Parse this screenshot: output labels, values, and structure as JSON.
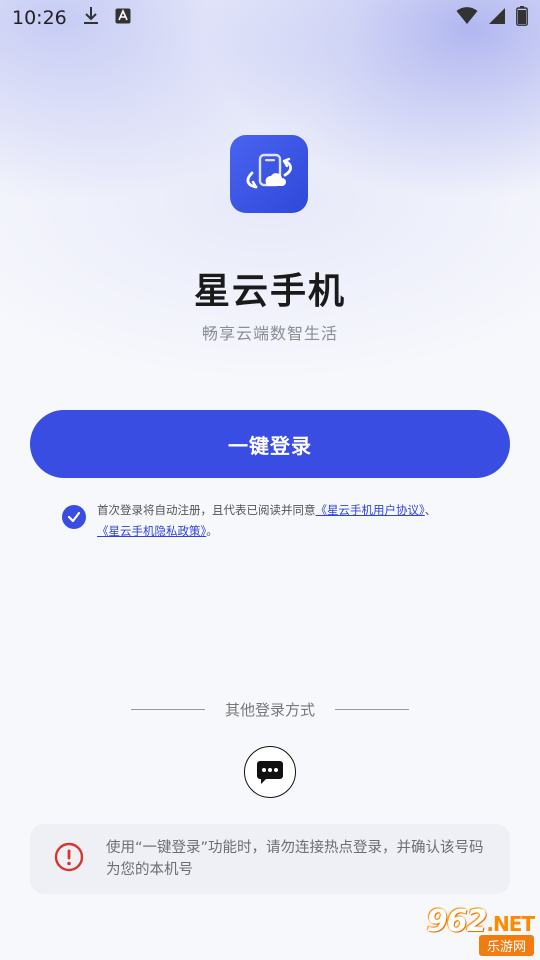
{
  "status_bar": {
    "time": "10:26",
    "icons": [
      "download-icon",
      "a-notification-icon",
      "wifi-icon",
      "cellular-signal-icon",
      "battery-icon"
    ]
  },
  "app": {
    "name": "星云手机",
    "subtitle": "畅享云端数智生活",
    "icon": "app-logo-icon",
    "brand_color": "#3a4de3"
  },
  "login": {
    "one_click_label": "一键登录"
  },
  "agreement": {
    "checked": true,
    "prefix": "首次登录将自动注册，且代表已阅读并同意",
    "user_agreement": "《星云手机用户协议》",
    "separator": "、",
    "privacy_policy": "《星云手机隐私政策》",
    "suffix": "。"
  },
  "other_login": {
    "label": "其他登录方式",
    "methods": [
      {
        "icon": "sms-message-icon"
      }
    ]
  },
  "notice": {
    "icon": "warning-icon",
    "text": "使用“一键登录”功能时，请勿连接热点登录，并确认该号码为您的本机号"
  },
  "watermark": {
    "top": "962",
    "net": ".NET",
    "bottom": "乐游网"
  }
}
